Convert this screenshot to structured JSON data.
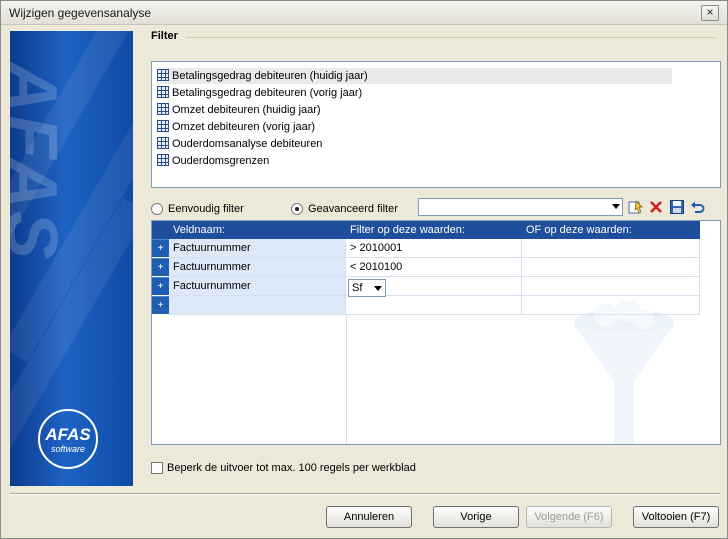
{
  "window": {
    "title": "Wijzigen gegevensanalyse",
    "close_label": "×"
  },
  "banner": {
    "vertical_text": "AFAS",
    "logo_main": "AFAS",
    "logo_sub": "software"
  },
  "filter": {
    "section_label": "Filter"
  },
  "datasets": [
    {
      "label": "Betalingsgedrag debiteuren (huidig jaar)",
      "selected": true
    },
    {
      "label": "Betalingsgedrag debiteuren (vorig jaar)",
      "selected": false
    },
    {
      "label": "Omzet debiteuren (huidig jaar)",
      "selected": false
    },
    {
      "label": "Omzet debiteuren (vorig jaar)",
      "selected": false
    },
    {
      "label": "Ouderdomsanalyse debiteuren",
      "selected": false
    },
    {
      "label": "Ouderdomsgrenzen",
      "selected": false
    }
  ],
  "filter_mode": {
    "simple_label": "Eenvoudig filter",
    "advanced_label": "Geavanceerd filter",
    "selected": "advanced",
    "saved_filter_value": ""
  },
  "toolbar_icons": [
    "select-filter-icon",
    "delete-icon",
    "save-icon",
    "undo-icon"
  ],
  "grid": {
    "columns": [
      "Veldnaam:",
      "Filter op deze waarden:",
      "OF op deze waarden:"
    ],
    "row_marker": "+",
    "rows": [
      {
        "field": "Factuurnummer",
        "filter": "> 2010001",
        "or": ""
      },
      {
        "field": "Factuurnummer",
        "filter": "< 2010100",
        "or": ""
      },
      {
        "field": "Factuurnummer",
        "filter": "Sf",
        "or": ""
      },
      {
        "field": "",
        "filter": "",
        "or": ""
      }
    ]
  },
  "limit_output": {
    "label": "Beperk de uitvoer tot max. 100 regels per werkblad",
    "checked": false
  },
  "buttons": {
    "cancel": "Annuleren",
    "previous": "Vorige",
    "next": "Volgende (F6)",
    "finish": "Voltooien (F7)"
  }
}
